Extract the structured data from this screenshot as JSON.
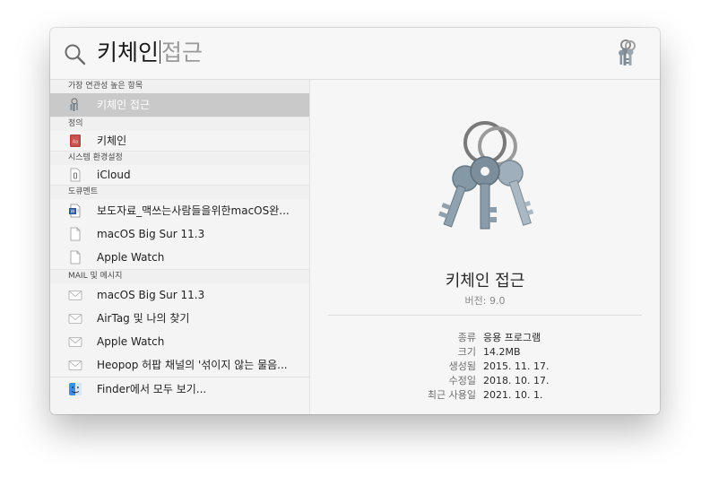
{
  "search": {
    "typed": "키체인",
    "completion": "접근"
  },
  "sections": [
    {
      "header": "가장 연관성 높은 항목",
      "items": [
        {
          "label": "키체인 접근",
          "icon": "keychain-icon",
          "selected": true
        }
      ]
    },
    {
      "header": "정의",
      "items": [
        {
          "label": "키체인",
          "icon": "dictionary-icon",
          "selected": false
        }
      ]
    },
    {
      "header": "시스템 환경설정",
      "items": [
        {
          "label": "iCloud",
          "icon": "preference-file-icon",
          "selected": false
        }
      ]
    },
    {
      "header": "도큐멘트",
      "items": [
        {
          "label": "보도자료_맥쓰는사람들을위한macOS완...",
          "icon": "word-document-icon",
          "selected": false
        },
        {
          "label": "macOS Big Sur 11.3",
          "icon": "document-icon",
          "selected": false
        },
        {
          "label": "Apple Watch",
          "icon": "document-icon",
          "selected": false
        }
      ]
    },
    {
      "header": "MAIL 및 메시지",
      "items": [
        {
          "label": "macOS Big Sur 11.3",
          "icon": "mail-icon",
          "selected": false
        },
        {
          "label": "AirTag 및 나의 찾기",
          "icon": "mail-icon",
          "selected": false
        },
        {
          "label": "Apple Watch",
          "icon": "mail-icon",
          "selected": false
        },
        {
          "label": "Heopop 허팝 채널의 '섞이지 않는 물음...",
          "icon": "mail-icon",
          "selected": false
        }
      ]
    }
  ],
  "finder_row": {
    "label": "Finder에서 모두 보기...",
    "icon": "finder-icon"
  },
  "preview": {
    "title": "키체인 접근",
    "version": "버전: 9.0",
    "meta": [
      {
        "key": "종류",
        "value": "응용 프로그램"
      },
      {
        "key": "크기",
        "value": "14.2MB"
      },
      {
        "key": "생성됨",
        "value": "2015. 11. 17."
      },
      {
        "key": "수정일",
        "value": "2018. 10. 17."
      },
      {
        "key": "최근 사용일",
        "value": "2021. 10. 1."
      }
    ]
  },
  "colors": {
    "selected_row": "#c9c9c9",
    "completion_text": "#9a9a9a"
  }
}
